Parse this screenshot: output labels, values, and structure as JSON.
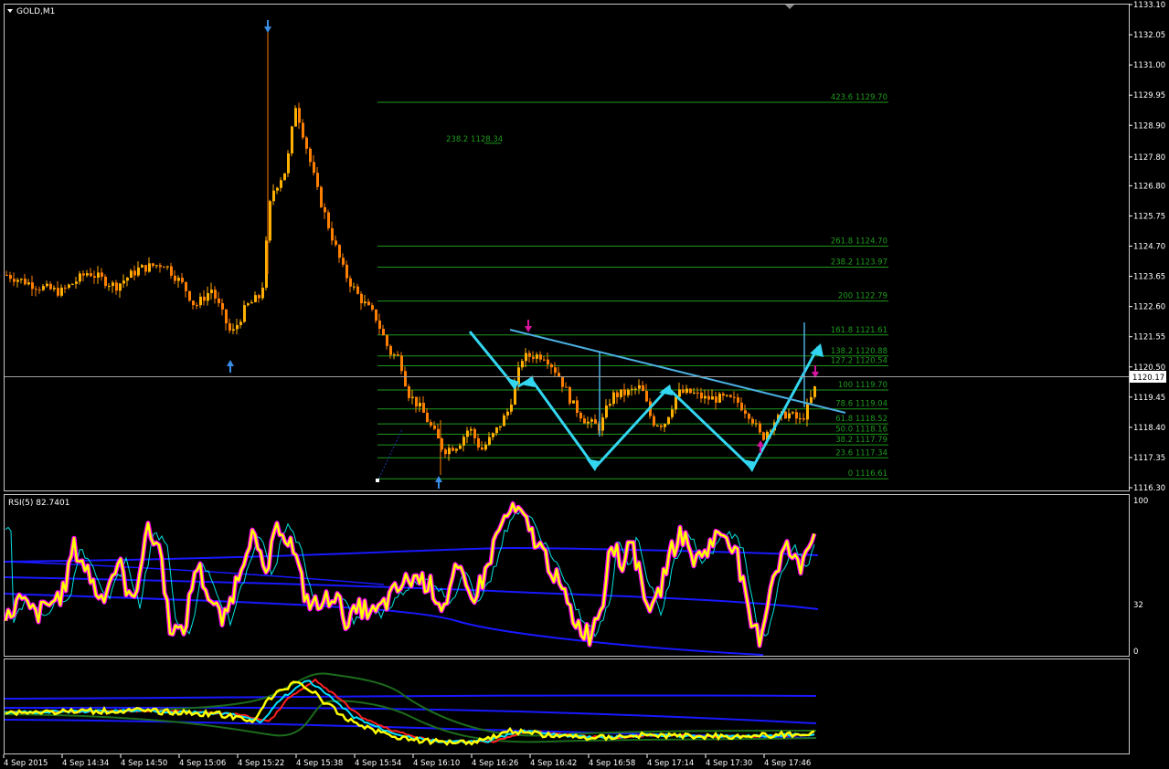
{
  "window": {
    "title": "GOLD,M1",
    "menu_icon": "triangle-down-icon"
  },
  "price_panel": {
    "price_axis_labels": [
      "1133.10",
      "1132.05",
      "1131.00",
      "1129.95",
      "1128.90",
      "1127.80",
      "1126.80",
      "1125.75",
      "1124.70",
      "1123.65",
      "1122.60",
      "1121.55",
      "1120.50",
      "1119.45",
      "1118.40",
      "1117.35",
      "1116.30"
    ],
    "current_price": "1120.17",
    "fib_levels_right": [
      {
        "label": "423.6 1129.70",
        "price": 1129.7
      },
      {
        "label": "261.8 1124.70",
        "price": 1124.7
      },
      {
        "label": "238.2 1123.97",
        "price": 1123.97
      },
      {
        "label": "200 1122.79",
        "price": 1122.79
      },
      {
        "label": "161.8 1121.61",
        "price": 1121.61
      },
      {
        "label": "138.2 1120.88",
        "price": 1120.88
      },
      {
        "label": "127.2 1120.54",
        "price": 1120.54
      },
      {
        "label": "100 1119.70",
        "price": 1119.7
      },
      {
        "label": "78.6 1119.04",
        "price": 1119.04
      },
      {
        "label": "61.8 1118.52",
        "price": 1118.52
      },
      {
        "label": "50.0 1118.16",
        "price": 1118.16
      },
      {
        "label": "38.2 1117.79",
        "price": 1117.79
      },
      {
        "label": "23.6 1117.34",
        "price": 1117.34
      },
      {
        "label": "0 1116.61",
        "price": 1116.61
      }
    ],
    "fib_level_floating": {
      "label": "238.2 1128.34",
      "price": 1128.34
    },
    "colors": {
      "candle": "#ff7f00",
      "candle_alt": "#ffb000",
      "fib": "#1e9a1e",
      "pattern": "#33d6f0",
      "arrow_blue": "#3a8ee6",
      "arrow_magenta": "#d4149c"
    }
  },
  "rsi_panel": {
    "label": "RSI(5) 82.7401",
    "axis_labels": [
      "100",
      "32",
      "0"
    ],
    "colors": {
      "rsi": "#ffff00",
      "rsi_halo": "#ff00ff",
      "signal": "#00e0e0",
      "bands": "#1818ff"
    }
  },
  "ma_panel": {
    "colors": {
      "yellow": "#ffff00",
      "red": "#ff2020",
      "cyan": "#00e0ff",
      "green": "#1c6b1c",
      "blue": "#1818ff"
    }
  },
  "time_axis": {
    "labels": [
      "4 Sep 2015",
      "4 Sep 14:34",
      "4 Sep 14:50",
      "4 Sep 15:06",
      "4 Sep 15:22",
      "4 Sep 15:38",
      "4 Sep 15:54",
      "4 Sep 16:10",
      "4 Sep 16:26",
      "4 Sep 16:42",
      "4 Sep 16:58",
      "4 Sep 17:14",
      "4 Sep 17:30",
      "4 Sep 17:46"
    ]
  },
  "chart_data": {
    "type": "line",
    "title": "GOLD,M1",
    "symbol": "GOLD",
    "timeframe": "M1",
    "ylim": [
      1116.3,
      1133.1
    ],
    "x": [
      "4 Sep 2015",
      "4 Sep 14:34",
      "4 Sep 14:50",
      "4 Sep 15:06",
      "4 Sep 15:22",
      "4 Sep 15:38",
      "4 Sep 15:54",
      "4 Sep 16:10",
      "4 Sep 16:26",
      "4 Sep 16:42",
      "4 Sep 16:58",
      "4 Sep 17:14",
      "4 Sep 17:30",
      "4 Sep 17:46"
    ],
    "series": [
      {
        "values": [
          1123.8,
          1123.4,
          1123.9,
          1123.2,
          1121.6,
          1129.6,
          1123.6,
          1118.0,
          1117.6,
          1121.0,
          1118.6,
          1119.8,
          1118.8,
          1119.5,
          1120.2
        ]
      }
    ],
    "grid": false
  }
}
